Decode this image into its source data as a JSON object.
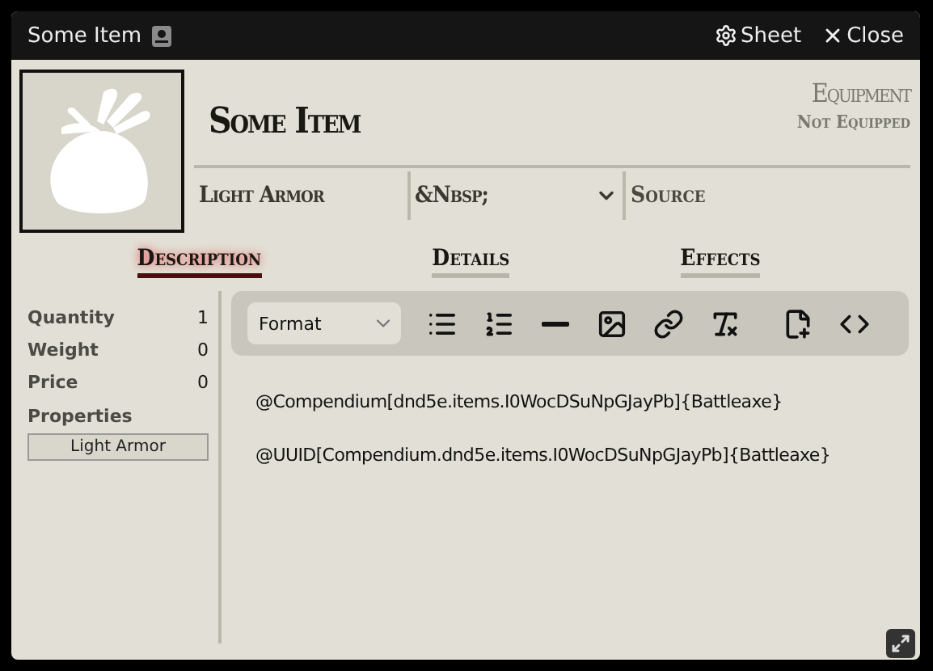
{
  "window": {
    "title": "Some Item",
    "controls": [
      {
        "kind": "sheet",
        "label": "Sheet"
      },
      {
        "kind": "close",
        "label": "Close"
      }
    ]
  },
  "header": {
    "name": "Some Item",
    "type": "Equipment",
    "status": "Not Equipped"
  },
  "fields": [
    {
      "kind": "text",
      "value": "Light Armor"
    },
    {
      "kind": "select",
      "value": "&Nbsp;"
    },
    {
      "kind": "input",
      "placeholder": "Source"
    }
  ],
  "tabs": [
    {
      "label": "Description",
      "selected": true
    },
    {
      "label": "Details",
      "selected": false
    },
    {
      "label": "Effects",
      "selected": false
    }
  ],
  "sidebar": {
    "stats": [
      {
        "label": "Quantity",
        "value": "1"
      },
      {
        "label": "Weight",
        "value": "0"
      },
      {
        "label": "Price",
        "value": "0"
      }
    ],
    "properties_label": "Properties",
    "properties": [
      "Light Armor"
    ]
  },
  "editor": {
    "format": "Format",
    "paragraphs": [
      "@Compendium[dnd5e.items.I0WocDSuNpGJayPb]{Battleaxe}",
      "@UUID[Compendium.dnd5e.items.I0WocDSuNpGJayPb]{Battleaxe}"
    ]
  }
}
